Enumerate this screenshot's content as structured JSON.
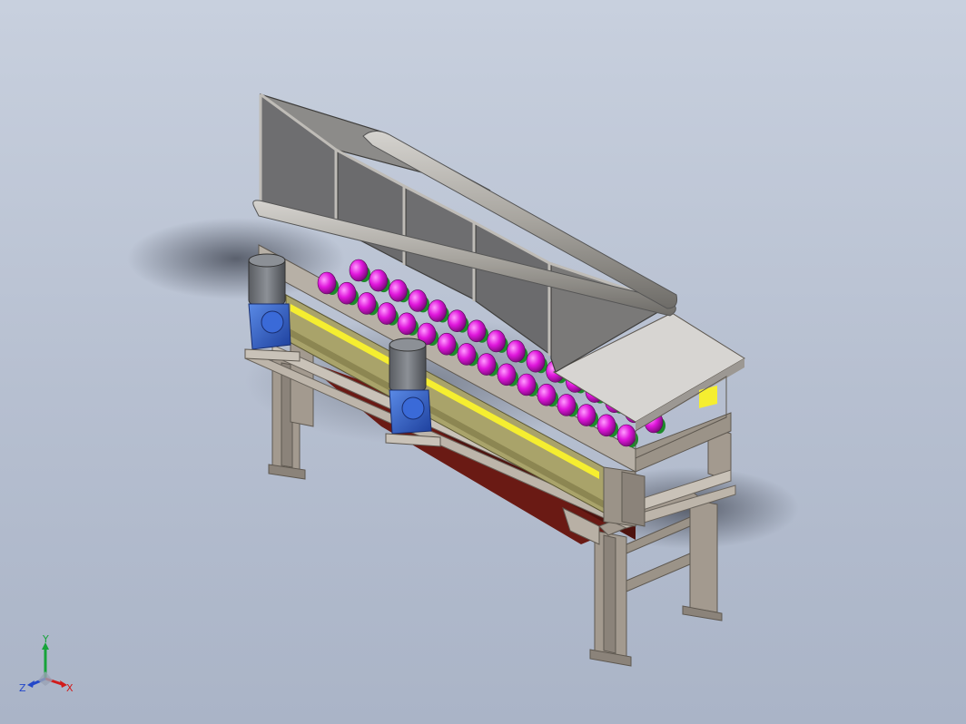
{
  "viewport": {
    "background_top": "#c8d0de",
    "background_bottom": "#aab4c7"
  },
  "model": {
    "frame_color": "#a39a8f",
    "roller_color": "#e016dc",
    "gear_color": "#1c8a2a",
    "motor_color": "#2a5fc7",
    "side_plate_color": "#a9a36a",
    "stripe_color": "#f5ee30",
    "underside_color": "#6a1a14",
    "guard_panel_color": "#6e6e70"
  },
  "triad": {
    "y_label": "Y",
    "x_label": "X",
    "z_label": "Z",
    "x_color": "#d11b1b",
    "y_color": "#17a33a",
    "z_color": "#2347c9"
  }
}
